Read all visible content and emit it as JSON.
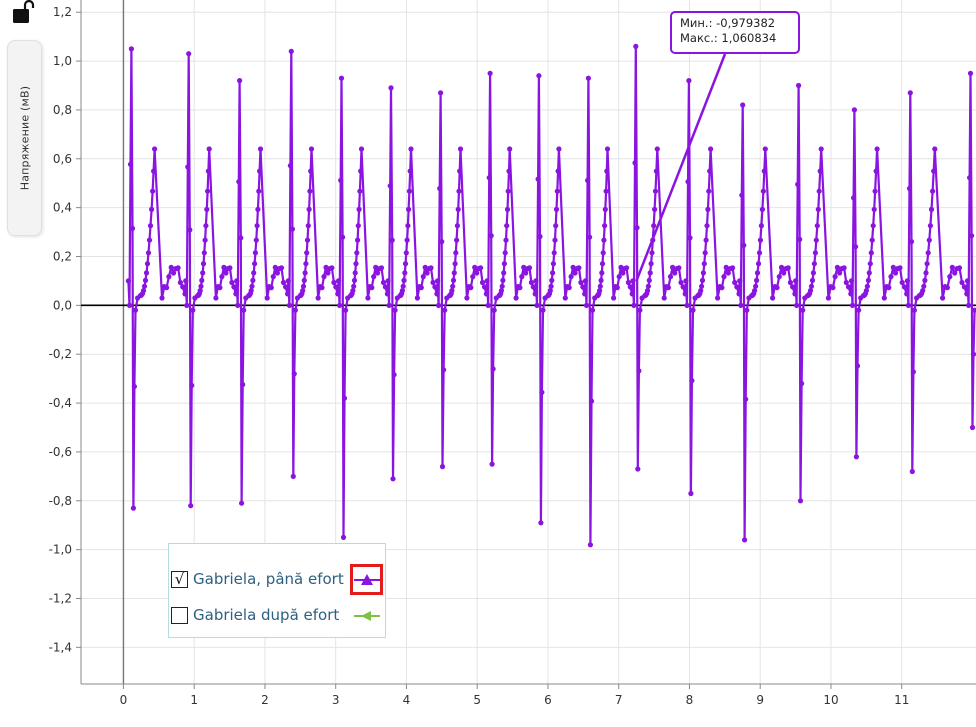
{
  "axis_label": "Напряжение (мВ)",
  "tooltip": {
    "min_text": "Мин.: -0,979382",
    "max_text": "Макс.: 1,060834"
  },
  "legend": {
    "items": [
      {
        "label": "Gabriela, până efort",
        "checked": true,
        "check_glyph": "√",
        "color": "#8a14e0",
        "icon": "triangle-up-icon"
      },
      {
        "label": "Gabriela după efort",
        "checked": false,
        "check_glyph": "",
        "color": "#7cc242",
        "icon": "triangle-left-icon"
      }
    ]
  },
  "colors": {
    "series": "#8a14e0",
    "highlight": "#e31b1b",
    "grid": "#e4e4e4",
    "zero_line": "#000000"
  },
  "icons": {
    "lock": "lock-open-icon"
  },
  "chart_data": {
    "type": "line",
    "xlabel": "",
    "ylabel": "Напряжение (мВ)",
    "xlim": [
      -0.6,
      12.05
    ],
    "ylim": [
      -1.55,
      1.25
    ],
    "x_ticks": [
      0,
      1,
      2,
      3,
      4,
      5,
      6,
      7,
      8,
      9,
      10,
      11
    ],
    "x_tick_labels": [
      "0",
      "1",
      "2",
      "3",
      "4",
      "5",
      "6",
      "7",
      "8",
      "9",
      "10",
      "11"
    ],
    "y_ticks": [
      1.2,
      1.0,
      0.8,
      0.6,
      0.4,
      0.2,
      0.0,
      -0.2,
      -0.4,
      -0.6,
      -0.8,
      -1.0,
      -1.2,
      -1.4
    ],
    "y_tick_labels": [
      "1,2",
      "1,0",
      "0,8",
      "0,6",
      "0,4",
      "0,2",
      "0,0",
      "-0,2",
      "-0,4",
      "-0,6",
      "-0,8",
      "-1,0",
      "-1,2",
      "-1,4"
    ],
    "grid": true,
    "legend_position": "bottom-left",
    "series": [
      {
        "name": "Gabriela, până efort",
        "min": -0.979382,
        "max": 1.060834,
        "beats": [
          {
            "x": 0.1,
            "peak": 1.05,
            "trough": -0.83
          },
          {
            "x": 0.91,
            "peak": 1.03,
            "trough": -0.82
          },
          {
            "x": 1.63,
            "peak": 0.92,
            "trough": -0.81
          },
          {
            "x": 2.36,
            "peak": 1.04,
            "trough": -0.7
          },
          {
            "x": 3.07,
            "peak": 0.93,
            "trough": -0.95
          },
          {
            "x": 3.77,
            "peak": 0.89,
            "trough": -0.71
          },
          {
            "x": 4.47,
            "peak": 0.87,
            "trough": -0.66
          },
          {
            "x": 5.17,
            "peak": 0.95,
            "trough": -0.65
          },
          {
            "x": 5.86,
            "peak": 0.94,
            "trough": -0.89
          },
          {
            "x": 6.56,
            "peak": 0.93,
            "trough": -0.98
          },
          {
            "x": 7.23,
            "peak": 1.06,
            "trough": -0.67
          },
          {
            "x": 7.98,
            "peak": 0.92,
            "trough": -0.77
          },
          {
            "x": 8.74,
            "peak": 0.82,
            "trough": -0.96
          },
          {
            "x": 9.53,
            "peak": 0.9,
            "trough": -0.8
          },
          {
            "x": 10.32,
            "peak": 0.8,
            "trough": -0.62
          },
          {
            "x": 11.11,
            "peak": 0.87,
            "trough": -0.68
          },
          {
            "x": 11.96,
            "peak": 0.95,
            "trough": -0.5
          }
        ]
      }
    ]
  }
}
